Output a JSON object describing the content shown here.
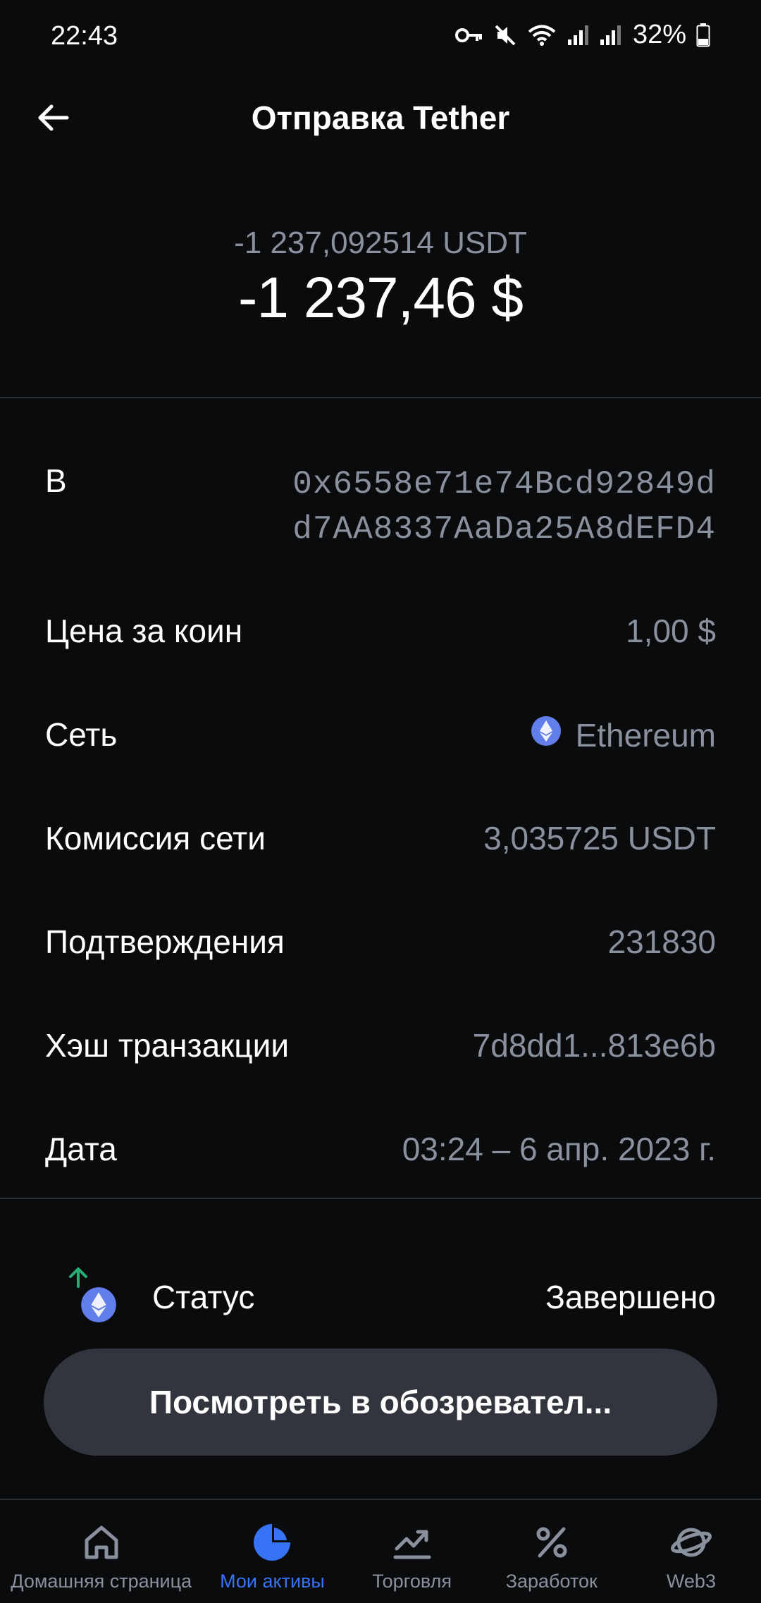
{
  "status_bar": {
    "time": "22:43",
    "battery": "32%",
    "icons": [
      "vpn-key-icon",
      "mute-icon",
      "wifi-icon",
      "signal-icon",
      "signal-icon",
      "battery-icon"
    ]
  },
  "header": {
    "title": "Отправка Tether",
    "back_icon": "arrow-left-icon"
  },
  "amount": {
    "crypto": "-1 237,092514 USDT",
    "fiat": "-1 237,46 $"
  },
  "details": {
    "to_label": "В",
    "to_address_line1": "0x6558e71e74Bcd92849d",
    "to_address_line2": "d7AA8337AaDa25A8dEFD4",
    "price_label": "Цена за коин",
    "price_value": "1,00 $",
    "network_label": "Сеть",
    "network_value": "Ethereum",
    "fee_label": "Комиссия сети",
    "fee_value": "3,035725 USDT",
    "confirmations_label": "Подтверждения",
    "confirmations_value": "231830",
    "hash_label": "Хэш транзакции",
    "hash_value": "7d8dd1...813e6b",
    "date_label": "Дата",
    "date_value": "03:24 – 6 апр. 2023 г."
  },
  "status": {
    "label": "Статус",
    "value": "Завершено"
  },
  "explorer_button": "Посмотреть в обозревател...",
  "nav": {
    "items": [
      {
        "label": "Домашняя страница",
        "icon": "home-icon"
      },
      {
        "label": "Мои активы",
        "icon": "pie-chart-icon",
        "active": true
      },
      {
        "label": "Торговля",
        "icon": "trending-up-icon"
      },
      {
        "label": "Заработок",
        "icon": "percent-icon"
      },
      {
        "label": "Web3",
        "icon": "planet-icon"
      }
    ]
  },
  "colors": {
    "background": "#0a0b0d",
    "secondary_text": "#8a919e",
    "accent": "#3773f5",
    "button_bg": "#32353d",
    "ethereum": "#627eea",
    "send_arrow": "#27ad75"
  }
}
